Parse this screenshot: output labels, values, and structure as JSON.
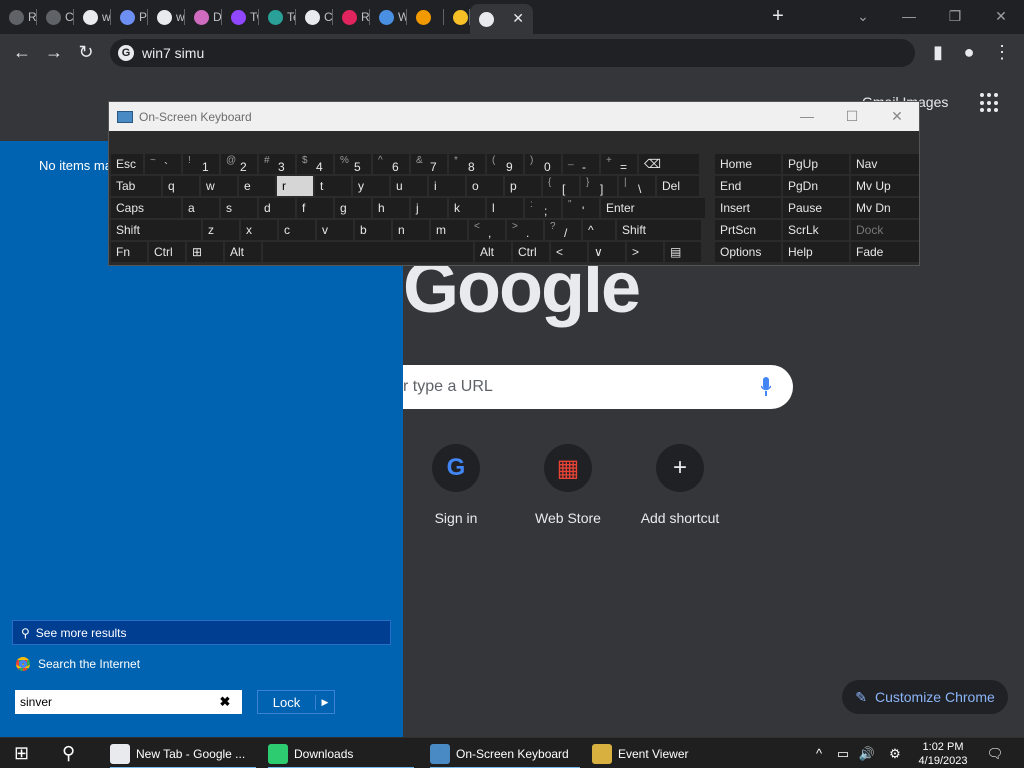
{
  "browser": {
    "tabs": [
      {
        "title": "Reli",
        "color": "#5f6368"
      },
      {
        "title": "Cla",
        "color": "#5f6368"
      },
      {
        "title": "win",
        "color": "#e8eaed"
      },
      {
        "title": "Pix",
        "color": "#6d8ff3"
      },
      {
        "title": "win",
        "color": "#e8eaed"
      },
      {
        "title": "Do",
        "color": "#d06cc0"
      },
      {
        "title": "Twi",
        "color": "#9146ff"
      },
      {
        "title": "Ter",
        "color": "#2aa198"
      },
      {
        "title": "Cre",
        "color": "#e8eaed"
      },
      {
        "title": "Rec",
        "color": "#e0245e"
      },
      {
        "title": "Wi",
        "color": "#4a90e2"
      },
      {
        "title": "",
        "color": "#f29900"
      },
      {
        "title": "",
        "color": "#f6c026"
      }
    ],
    "active_tab_close": "✕",
    "new_tab": "+",
    "window_controls": {
      "dropdown": "⌄",
      "minimize": "—",
      "restore": "❐",
      "close": "✕"
    },
    "nav": {
      "back": "←",
      "forward": "→",
      "reload": "↻"
    },
    "omnibox": {
      "value": "win7 simu",
      "icon": "G"
    },
    "toolbar_icons": {
      "sidepanel": "▮",
      "profile": "●",
      "menu": "⋮"
    }
  },
  "ntp": {
    "header_links": "Gmail Images",
    "logo": "Google",
    "search_placeholder": "r type a URL",
    "shortcuts": [
      {
        "label": "Sign in",
        "glyph": "G",
        "color": "#4285f4"
      },
      {
        "label": "Web Store",
        "glyph": "▦",
        "color": "#ea4335"
      },
      {
        "label": "Add shortcut",
        "glyph": "+",
        "color": "#e8eaed"
      }
    ],
    "customize_label": "Customize Chrome",
    "customize_icon": "✎"
  },
  "startmenu": {
    "no_items": "No items ma",
    "see_more": "See more results",
    "search_internet": "Search the Internet",
    "search_value": "sinver",
    "clear": "✖",
    "lock_label": "Lock",
    "lock_arrow": "▶"
  },
  "osk": {
    "title": "On-Screen Keyboard",
    "controls": {
      "minimize": "—",
      "maximize": "☐",
      "close": "✕"
    },
    "row1": [
      {
        "l": "Esc",
        "w": 34
      },
      {
        "s": "~",
        "m": "`",
        "w": 38
      },
      {
        "s": "!",
        "m": "1",
        "w": 38
      },
      {
        "s": "@",
        "m": "2",
        "w": 38
      },
      {
        "s": "#",
        "m": "3",
        "w": 38
      },
      {
        "s": "$",
        "m": "4",
        "w": 38
      },
      {
        "s": "%",
        "m": "5",
        "w": 38
      },
      {
        "s": "^",
        "m": "6",
        "w": 38
      },
      {
        "s": "&",
        "m": "7",
        "w": 38
      },
      {
        "s": "*",
        "m": "8",
        "w": 38
      },
      {
        "s": "(",
        "m": "9",
        "w": 38
      },
      {
        "s": ")",
        "m": "0",
        "w": 38
      },
      {
        "s": "_",
        "m": "-",
        "w": 38
      },
      {
        "s": "+",
        "m": "=",
        "w": 38
      },
      {
        "l": "⌫",
        "w": 62
      }
    ],
    "row2": [
      {
        "l": "Tab",
        "w": 52
      },
      {
        "l": "q",
        "w": 38
      },
      {
        "l": "w",
        "w": 38
      },
      {
        "l": "e",
        "w": 38
      },
      {
        "l": "r",
        "w": 38,
        "lit": true
      },
      {
        "l": "t",
        "w": 38
      },
      {
        "l": "y",
        "w": 38
      },
      {
        "l": "u",
        "w": 38
      },
      {
        "l": "i",
        "w": 38
      },
      {
        "l": "o",
        "w": 38
      },
      {
        "l": "p",
        "w": 38
      },
      {
        "s": "{",
        "m": "[",
        "w": 38
      },
      {
        "s": "}",
        "m": "]",
        "w": 38
      },
      {
        "s": "|",
        "m": "\\",
        "w": 38
      },
      {
        "l": "Del",
        "w": 44
      }
    ],
    "row3": [
      {
        "l": "Caps",
        "w": 72
      },
      {
        "l": "a",
        "w": 38
      },
      {
        "l": "s",
        "w": 38
      },
      {
        "l": "d",
        "w": 38
      },
      {
        "l": "f",
        "w": 38
      },
      {
        "l": "g",
        "w": 38
      },
      {
        "l": "h",
        "w": 38
      },
      {
        "l": "j",
        "w": 38
      },
      {
        "l": "k",
        "w": 38
      },
      {
        "l": "l",
        "w": 38
      },
      {
        "s": ":",
        "m": ";",
        "w": 38
      },
      {
        "s": "\"",
        "m": "'",
        "w": 38
      },
      {
        "l": "Enter",
        "w": 106
      }
    ],
    "row4": [
      {
        "l": "Shift",
        "w": 92
      },
      {
        "l": "z",
        "w": 38
      },
      {
        "l": "x",
        "w": 38
      },
      {
        "l": "c",
        "w": 38
      },
      {
        "l": "v",
        "w": 38
      },
      {
        "l": "b",
        "w": 38
      },
      {
        "l": "n",
        "w": 38
      },
      {
        "l": "m",
        "w": 38
      },
      {
        "s": "<",
        "m": ",",
        "w": 38
      },
      {
        "s": ">",
        "m": ".",
        "w": 38
      },
      {
        "s": "?",
        "m": "/",
        "w": 38
      },
      {
        "l": "^",
        "w": 34
      },
      {
        "l": "Shift",
        "w": 86
      }
    ],
    "row5": [
      {
        "l": "Fn",
        "w": 38
      },
      {
        "l": "Ctrl",
        "w": 38
      },
      {
        "l": "⊞",
        "w": 38
      },
      {
        "l": "Alt",
        "w": 38
      },
      {
        "l": "",
        "w": 212
      },
      {
        "l": "Alt",
        "w": 38
      },
      {
        "l": "Ctrl",
        "w": 38
      },
      {
        "l": "<",
        "w": 38
      },
      {
        "l": "∨",
        "w": 38
      },
      {
        "l": ">",
        "w": 38
      },
      {
        "l": "▤",
        "w": 38
      }
    ],
    "nav_keys": [
      [
        "Home",
        "PgUp",
        "Nav"
      ],
      [
        "End",
        "PgDn",
        "Mv Up"
      ],
      [
        "Insert",
        "Pause",
        "Mv Dn"
      ],
      [
        "PrtScn",
        "ScrLk",
        "Dock"
      ],
      [
        "Options",
        "Help",
        "Fade"
      ]
    ]
  },
  "taskbar": {
    "start": "⊞",
    "search": "⚲",
    "items": [
      {
        "label": "New Tab - Google ...",
        "color": "#e8eaed"
      },
      {
        "label": "Downloads",
        "color": "#2ecc71"
      },
      {
        "label": "On-Screen Keyboard",
        "color": "#4a8ac4"
      },
      {
        "label": "Event Viewer",
        "color": "#d8b040"
      }
    ],
    "tray": [
      "^",
      "▭",
      "🔊",
      "⚙"
    ],
    "time": "1:02 PM",
    "date": "4/19/2023",
    "notify": "🗨"
  }
}
